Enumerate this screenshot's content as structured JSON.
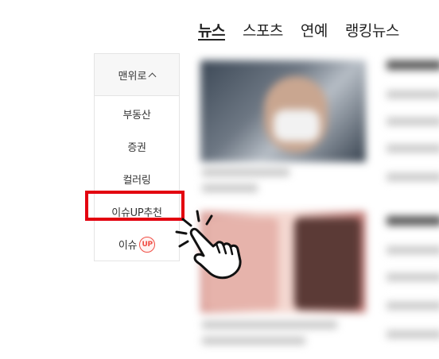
{
  "topnav": {
    "tabs": [
      {
        "label": "뉴스",
        "active": true
      },
      {
        "label": "스포츠",
        "active": false
      },
      {
        "label": "연예",
        "active": false
      },
      {
        "label": "랭킹뉴스",
        "active": false
      }
    ]
  },
  "sidemenu": {
    "top_label": "맨위로",
    "items": [
      {
        "label": "부동산"
      },
      {
        "label": "증권"
      },
      {
        "label": "컬러링"
      },
      {
        "label": "이슈UP추천"
      },
      {
        "label": "이슈",
        "badge": "UP"
      }
    ]
  },
  "colors": {
    "highlight": "#e3000f",
    "badge": "#f04e45"
  },
  "icons": {
    "cursor": "pointing-hand-cursor-icon",
    "caret": "caret-up-icon"
  }
}
